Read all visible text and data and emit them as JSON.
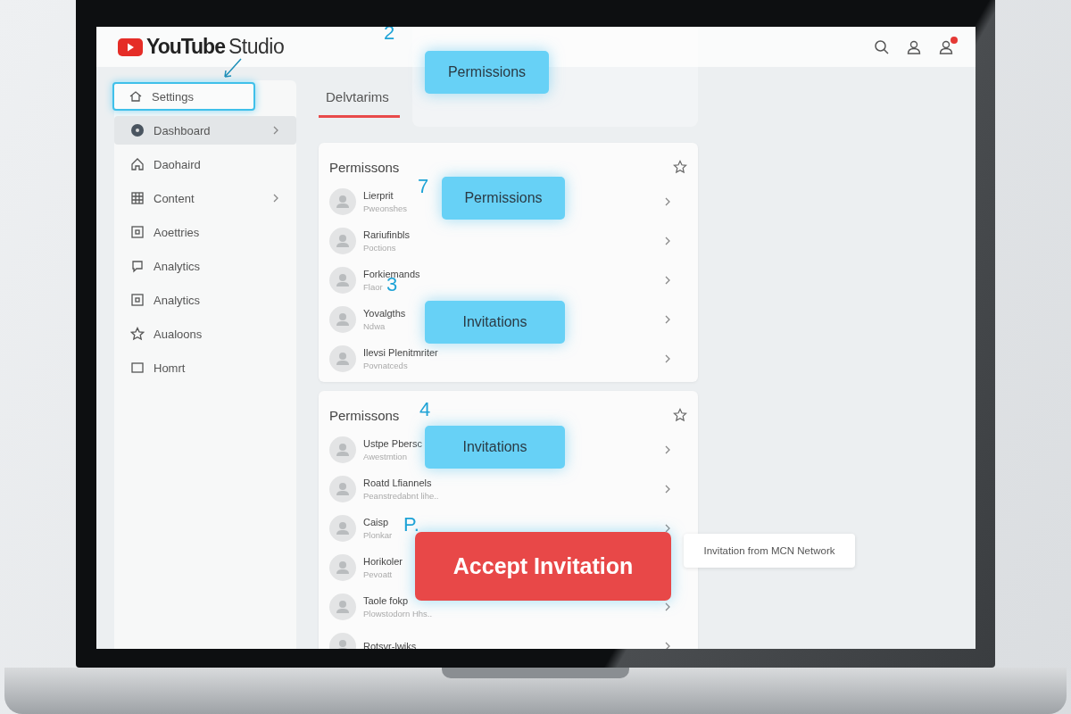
{
  "header": {
    "logo_word": "YouTube",
    "logo_suffix": "Studio",
    "notification_badge": true
  },
  "sidebar": {
    "items": [
      {
        "label": "Settings",
        "selected": true,
        "highlighted": false,
        "chevron": false
      },
      {
        "label": "Dashboard",
        "selected": false,
        "highlighted": true,
        "chevron": true
      },
      {
        "label": "Daohaird",
        "selected": false,
        "highlighted": false,
        "chevron": false
      },
      {
        "label": "Content",
        "selected": false,
        "highlighted": false,
        "chevron": true
      },
      {
        "label": "Aoettries",
        "selected": false,
        "highlighted": false,
        "chevron": false
      },
      {
        "label": "Analytics",
        "selected": false,
        "highlighted": false,
        "chevron": false
      },
      {
        "label": "Analytics",
        "selected": false,
        "highlighted": false,
        "chevron": false
      },
      {
        "label": "Aualoons",
        "selected": false,
        "highlighted": false,
        "chevron": false
      },
      {
        "label": "Homrt",
        "selected": false,
        "highlighted": false,
        "chevron": false
      }
    ]
  },
  "tabs": [
    {
      "label": "Delvtarims",
      "selected": true
    }
  ],
  "cards": [
    {
      "title": "Permissons",
      "rows": [
        {
          "title": "Lierprit",
          "subtitle": "Pweonshes"
        },
        {
          "title": "Rariufinbls",
          "subtitle": "Poctions"
        },
        {
          "title": "Forkiemands",
          "subtitle": "Flaor"
        },
        {
          "title": "Yovalgths",
          "subtitle": "Ndwa"
        },
        {
          "title": "Ilevsi Plenitmriter",
          "subtitle": "Povnatceds"
        }
      ]
    },
    {
      "title": "Permissons",
      "rows": [
        {
          "title": "Ustpe Pbersc",
          "subtitle": "Awestmtion"
        },
        {
          "title": "Roatd Lfiannels",
          "subtitle": "Peanstredabnt lihe.."
        },
        {
          "title": "Caisp",
          "subtitle": "Plonkar"
        },
        {
          "title": "Horikoler",
          "subtitle": "Pevoatt"
        },
        {
          "title": "Taole fokp",
          "subtitle": "Plowstodorn Hhs.."
        },
        {
          "title": "Rotsvr-lwiks"
        }
      ]
    }
  ],
  "callouts": [
    {
      "kind": "info",
      "label": "Permissions"
    },
    {
      "kind": "info",
      "label": "Permissions"
    },
    {
      "kind": "info",
      "label": "Invitations"
    },
    {
      "kind": "info",
      "label": "Invitations"
    },
    {
      "kind": "primary",
      "label": "Accept Invitation"
    }
  ],
  "tooltip": "Invitation from MCN Network",
  "steps": [
    "2",
    "7",
    "3",
    "4",
    "P."
  ]
}
